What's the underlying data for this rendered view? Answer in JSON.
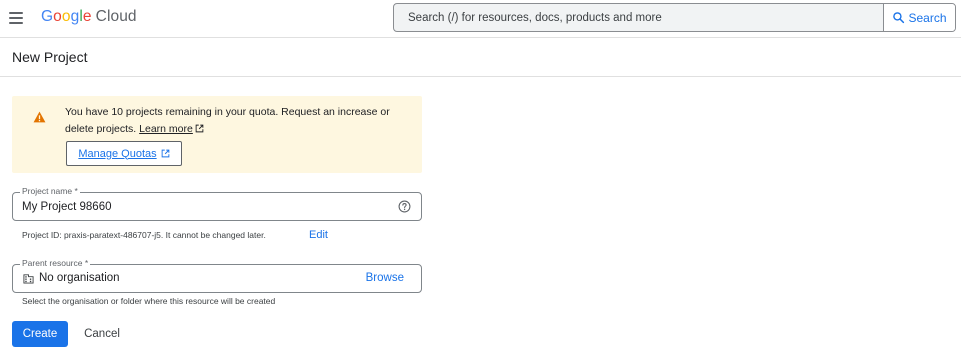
{
  "header": {
    "logo": {
      "g1": "G",
      "o1": "o",
      "o2": "o",
      "g2": "g",
      "l": "l",
      "e": "e",
      "product": "Cloud"
    },
    "search": {
      "placeholder": "Search (/) for resources, docs, products and more",
      "button_label": "Search"
    }
  },
  "page": {
    "title": "New Project"
  },
  "quota_banner": {
    "message": "You have 10 projects remaining in your quota. Request an increase or delete projects.",
    "learn_more_label": "Learn more",
    "manage_quotas_label": "Manage Quotas"
  },
  "form": {
    "project_name": {
      "label": "Project name *",
      "value": "My Project 98660"
    },
    "project_id_hint": "Project ID: praxis-paratext-486707-j5. It cannot be changed later.",
    "edit_label": "Edit",
    "parent_resource": {
      "label": "Parent resource *",
      "value": "No organisation",
      "browse_label": "Browse"
    },
    "parent_hint": "Select the organisation or folder where this resource will be created"
  },
  "actions": {
    "create_label": "Create",
    "cancel_label": "Cancel"
  },
  "colors": {
    "accent": "#1a73e8",
    "warning_bg": "#fef7e0",
    "warning_icon": "#e37400"
  }
}
